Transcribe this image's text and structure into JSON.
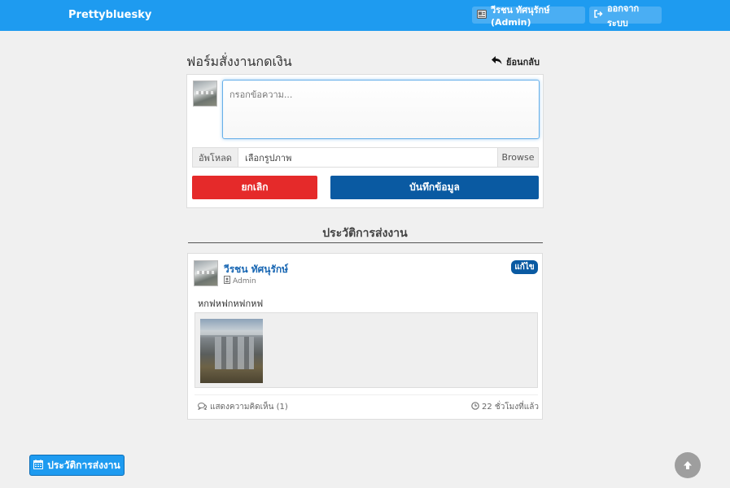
{
  "header": {
    "brand": "Prettybluesky",
    "user_label": "วีรชน ทัศนุรักษ์ (Admin)",
    "logout_label": "ออกจากระบบ"
  },
  "form": {
    "title": "ฟอร์มสั่งงานกดเงิน",
    "back_label": "ย้อนกลับ",
    "message_placeholder": "กรอกข้อความ...",
    "upload_label": "อัพโหลด",
    "file_placeholder": "เลือกรูปภาพ",
    "browse_label": "Browse",
    "cancel_label": "ยกเลิก",
    "save_label": "บันทึกข้อมูล"
  },
  "history": {
    "section_title": "ประวัติการส่งงาน",
    "post": {
      "author": "วีรชน ทัศนุรักษ์",
      "role": "Admin",
      "edit_label": "แก้ไข",
      "text": "หกฟหฟกหฟกหฟ",
      "comments_label": "แสดงความคิดเห็น (1)",
      "time": "22 ชั่วโมงที่แล้ว"
    }
  },
  "footer": {
    "history_button": "ประวัติการส่งงาน"
  },
  "icons": {
    "user": "user-card-icon",
    "logout": "sign-out-icon",
    "back": "reply-arrow-icon",
    "role": "id-badge-icon",
    "comments": "comments-icon",
    "clock": "clock-icon",
    "calendar": "calendar-icon",
    "scroll_top": "arrow-up-circle-icon"
  },
  "colors": {
    "topbar": "#1e9bf0",
    "cancel": "#e52a2a",
    "save": "#0a5aa2",
    "author": "#1967b3"
  }
}
